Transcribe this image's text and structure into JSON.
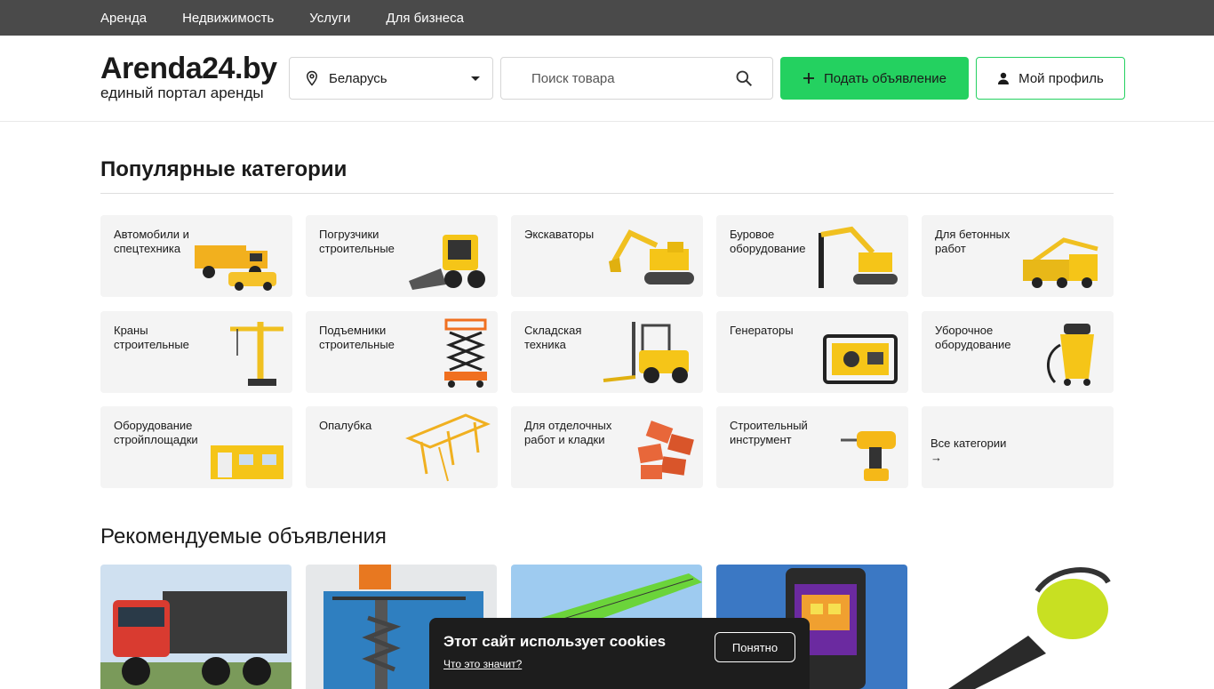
{
  "nav": {
    "items": [
      "Аренда",
      "Недвижимость",
      "Услуги",
      "Для бизнеса"
    ]
  },
  "logo": {
    "title": "Arenda24.by",
    "subtitle": "единый портал аренды"
  },
  "region": {
    "value": "Беларусь"
  },
  "search": {
    "placeholder": "Поиск товара"
  },
  "actions": {
    "add_label": "Подать объявление",
    "profile_label": "Мой профиль"
  },
  "popular": {
    "title": "Популярные категории",
    "categories": [
      "Автомобили и спецтехника",
      "Погрузчики строительные",
      "Экскаваторы",
      "Буровое оборудование",
      "Для бетонных работ",
      "Краны строительные",
      "Подъемники строительные",
      "Складская техника",
      "Генераторы",
      "Уборочное оборудование",
      "Оборудование стройплощадки",
      "Опалубка",
      "Для отделочных работ и кладки",
      "Строительный инструмент"
    ],
    "all_label": "Все категории"
  },
  "recommended": {
    "title": "Рекомендуемые объявления"
  },
  "cookie": {
    "title": "Этот сайт использует cookies",
    "link": "Что это значит?",
    "button": "Понятно"
  },
  "colors": {
    "accent": "#24d160",
    "topbar": "#4a4a4a",
    "tile": "#f4f4f4",
    "cookie_bg": "#1d1d1d"
  }
}
